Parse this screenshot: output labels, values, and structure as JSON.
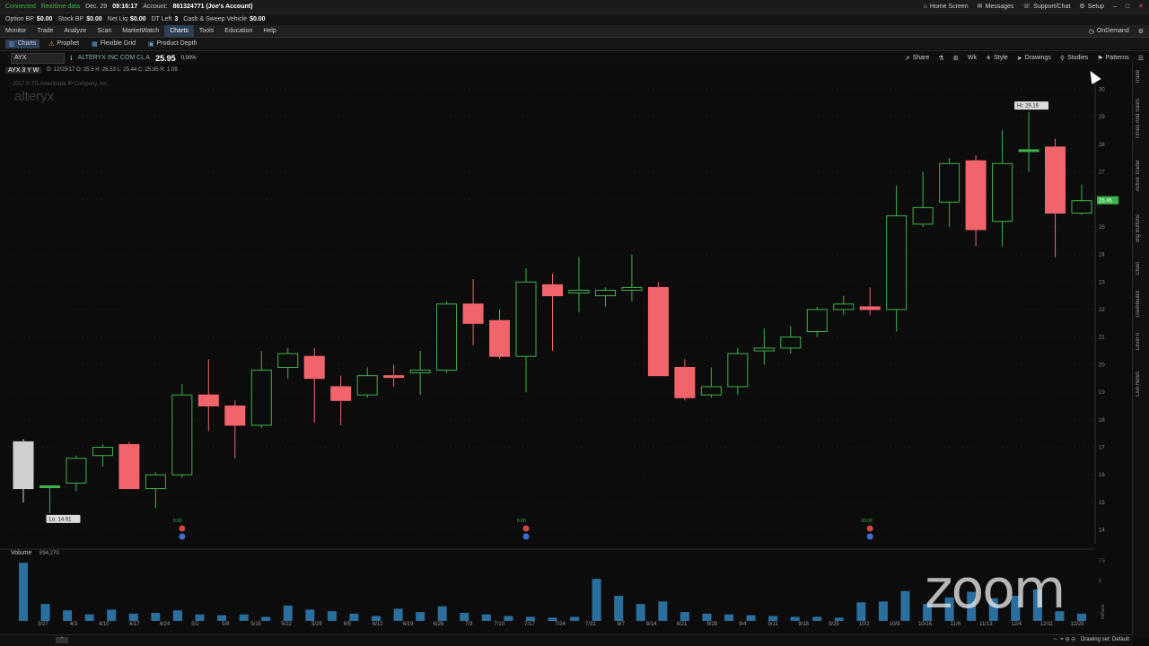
{
  "status_bar": {
    "connected": "Connected",
    "realtime": "Realtime data",
    "date": "Dec. 29",
    "time": "09:16:17",
    "account_label": "Account:",
    "account_value": "861324771 (Joe's Account)",
    "home_screen": "Home Screen",
    "messages": "Messages",
    "support": "Support/Chat",
    "setup": "Setup"
  },
  "balances": [
    {
      "label": "Option BP",
      "value": "$0.00"
    },
    {
      "label": "Stock BP",
      "value": "$0.00"
    },
    {
      "label": "Net Liq",
      "value": "$0.00"
    },
    {
      "label": "DT Left",
      "value": "3"
    },
    {
      "label": "Cash & Sweep Vehicle",
      "value": "$0.00"
    }
  ],
  "menu": [
    "Monitor",
    "Trade",
    "Analyze",
    "Scan",
    "MarketWatch",
    "Charts",
    "Tools",
    "Education",
    "Help"
  ],
  "menu_active": "Charts",
  "ondemand": "OnDemand",
  "subtabs": [
    {
      "label": "Charts",
      "icon": "chart-icon",
      "active": true
    },
    {
      "label": "Prophet",
      "icon": "warning-icon",
      "active": false
    },
    {
      "label": "Flexible Grid",
      "icon": "grid-icon",
      "active": false
    },
    {
      "label": "Product Depth",
      "icon": "depth-icon",
      "active": false
    }
  ],
  "toolbar": {
    "symbol": "AYX",
    "company": "ALTERYX INC COM CL A",
    "price": "25.95",
    "change": "0.00%",
    "share": "Share",
    "timeframe": "Wk",
    "style": "Style",
    "drawings": "Drawings",
    "studies": "Studies",
    "patterns": "Patterns"
  },
  "chart_header": {
    "period": "AYX 3 Y W",
    "ohlc": "D: 12/25/17   O: 25.5   H: 26.53   L: 25.44   C: 25.95   R: 1.09",
    "copyright": "2017 © TD Ameritrade IP Company, Inc.",
    "watermark": "alteryx"
  },
  "volume_label": "Volume",
  "volume_value": "894,270",
  "drawing_set": "Drawing set: Default",
  "side_tabs": [
    "Trade",
    "Times And Sales",
    "Active Trader",
    "Big Buttons",
    "Chart",
    "Dashboard",
    "Level II",
    "Live News"
  ],
  "zoom_logo": "zoom",
  "colors": {
    "up": "#3cb54a",
    "down": "#f2646b",
    "volume": "#2a6f9e",
    "last": "#3cb54a"
  },
  "chart_data": {
    "type": "candlestick",
    "ylim": [
      13.5,
      30.5
    ],
    "y_ticks": [
      14,
      15,
      16,
      17,
      18,
      19,
      20,
      21,
      22,
      23,
      24,
      25,
      26,
      27,
      28,
      29,
      30
    ],
    "x_labels": [
      "3/27",
      "4/3",
      "4/10",
      "4/17",
      "4/24",
      "5/1",
      "5/8",
      "5/15",
      "5/22",
      "5/29",
      "6/5",
      "6/12",
      "6/19",
      "6/26",
      "7/3",
      "7/10",
      "7/17",
      "7/24",
      "7/31",
      "8/7",
      "8/14",
      "8/21",
      "8/28",
      "9/4",
      "9/11",
      "9/18",
      "9/25",
      "10/2",
      "10/9",
      "10/16",
      "11/6",
      "11/13",
      "12/4",
      "12/11",
      "12/25"
    ],
    "candles": [
      {
        "x": "3/27",
        "o": 17.2,
        "h": 17.3,
        "l": 15.0,
        "c": 15.5,
        "first": true
      },
      {
        "x": "4/3",
        "o": 15.6,
        "h": 15.6,
        "l": 14.61,
        "c": 15.6
      },
      {
        "x": "4/10",
        "o": 15.7,
        "h": 16.7,
        "l": 15.4,
        "c": 16.6
      },
      {
        "x": "4/17",
        "o": 16.7,
        "h": 17.1,
        "l": 16.3,
        "c": 17.0
      },
      {
        "x": "4/24",
        "o": 17.1,
        "h": 17.2,
        "l": 15.5,
        "c": 15.5
      },
      {
        "x": "5/1",
        "o": 15.5,
        "h": 16.1,
        "l": 14.8,
        "c": 16.0
      },
      {
        "x": "5/8",
        "o": 16.0,
        "h": 19.3,
        "l": 15.9,
        "c": 18.9
      },
      {
        "x": "5/15",
        "o": 18.9,
        "h": 20.2,
        "l": 17.6,
        "c": 18.5
      },
      {
        "x": "5/22",
        "o": 18.5,
        "h": 18.7,
        "l": 16.6,
        "c": 17.8
      },
      {
        "x": "5/29",
        "o": 17.8,
        "h": 20.5,
        "l": 17.7,
        "c": 19.8
      },
      {
        "x": "6/5",
        "o": 19.9,
        "h": 20.6,
        "l": 19.5,
        "c": 20.4
      },
      {
        "x": "6/12",
        "o": 20.3,
        "h": 20.6,
        "l": 17.9,
        "c": 19.5
      },
      {
        "x": "6/19",
        "o": 19.2,
        "h": 19.6,
        "l": 17.8,
        "c": 18.7
      },
      {
        "x": "6/26",
        "o": 18.9,
        "h": 19.9,
        "l": 18.8,
        "c": 19.6
      },
      {
        "x": "7/3",
        "o": 19.6,
        "h": 20.0,
        "l": 19.2,
        "c": 19.55
      },
      {
        "x": "7/10",
        "o": 19.7,
        "h": 20.5,
        "l": 18.9,
        "c": 19.8
      },
      {
        "x": "7/17",
        "o": 19.8,
        "h": 22.3,
        "l": 19.7,
        "c": 22.2
      },
      {
        "x": "7/24",
        "o": 22.2,
        "h": 23.1,
        "l": 20.7,
        "c": 21.5
      },
      {
        "x": "7/31",
        "o": 21.6,
        "h": 22.0,
        "l": 20.2,
        "c": 20.3
      },
      {
        "x": "8/7",
        "o": 20.3,
        "h": 23.5,
        "l": 19.0,
        "c": 23.0
      },
      {
        "x": "8/14",
        "o": 22.9,
        "h": 23.3,
        "l": 20.5,
        "c": 22.5
      },
      {
        "x": "8/21",
        "o": 22.6,
        "h": 23.9,
        "l": 21.9,
        "c": 22.7
      },
      {
        "x": "8/28",
        "o": 22.5,
        "h": 22.8,
        "l": 22.1,
        "c": 22.7
      },
      {
        "x": "9/4",
        "o": 22.7,
        "h": 24.0,
        "l": 22.3,
        "c": 22.8
      },
      {
        "x": "9/11",
        "o": 22.8,
        "h": 23.0,
        "l": 19.6,
        "c": 19.6
      },
      {
        "x": "9/18",
        "o": 19.9,
        "h": 20.2,
        "l": 18.7,
        "c": 18.8
      },
      {
        "x": "9/25",
        "o": 18.9,
        "h": 19.9,
        "l": 18.8,
        "c": 19.2
      },
      {
        "x": "10/2",
        "o": 19.2,
        "h": 20.6,
        "l": 18.9,
        "c": 20.4
      },
      {
        "x": "10/9",
        "o": 20.5,
        "h": 21.3,
        "l": 20.0,
        "c": 20.6
      },
      {
        "x": "10/16",
        "o": 20.6,
        "h": 21.4,
        "l": 20.4,
        "c": 21.0
      },
      {
        "x": "10/23",
        "o": 21.2,
        "h": 22.1,
        "l": 21.0,
        "c": 22.0
      },
      {
        "x": "10/30",
        "o": 22.0,
        "h": 22.5,
        "l": 21.8,
        "c": 22.2
      },
      {
        "x": "11/6",
        "o": 22.1,
        "h": 22.8,
        "l": 21.8,
        "c": 22.0
      },
      {
        "x": "11/13",
        "o": 22.0,
        "h": 26.5,
        "l": 21.2,
        "c": 25.4
      },
      {
        "x": "11/20",
        "o": 25.1,
        "h": 27.0,
        "l": 25.0,
        "c": 25.7
      },
      {
        "x": "11/27",
        "o": 25.9,
        "h": 27.5,
        "l": 25.0,
        "c": 27.3
      },
      {
        "x": "12/4",
        "o": 27.4,
        "h": 27.6,
        "l": 24.3,
        "c": 24.9
      },
      {
        "x": "12/11",
        "o": 25.2,
        "h": 28.5,
        "l": 24.3,
        "c": 27.3
      },
      {
        "x": "12/18",
        "o": 27.8,
        "h": 29.16,
        "l": 27.0,
        "c": 27.8
      },
      {
        "x": "12/25a",
        "o": 27.9,
        "h": 28.2,
        "l": 23.9,
        "c": 25.5
      },
      {
        "x": "12/25",
        "o": 25.5,
        "h": 26.53,
        "l": 25.44,
        "c": 25.95
      }
    ],
    "high_label": "Hi: 29.16",
    "low_label": "Lo: 14.61",
    "last_price": "25.95",
    "volume_ticks": [
      "7.5",
      "5"
    ],
    "volume_unit": "millions",
    "volume": [
      7.2,
      2.1,
      1.3,
      0.8,
      1.4,
      0.9,
      1.0,
      1.3,
      0.8,
      0.7,
      0.8,
      0.5,
      1.9,
      1.4,
      1.2,
      0.9,
      0.6,
      1.5,
      1.1,
      1.8,
      1.0,
      0.8,
      0.6,
      0.5,
      0.4,
      0.5,
      5.2,
      3.1,
      2.1,
      2.4,
      1.1,
      0.9,
      0.8,
      0.7,
      0.6,
      0.5,
      0.5,
      0.4,
      2.3,
      2.4,
      3.7,
      2.1,
      2.9,
      3.6,
      2.8,
      3.1,
      3.9,
      1.2,
      0.9
    ],
    "events": [
      {
        "x": "5/8",
        "label": "0.00"
      },
      {
        "x": "8/7",
        "label": "0.00"
      },
      {
        "x": "11/6",
        "label": "00.00"
      }
    ]
  }
}
